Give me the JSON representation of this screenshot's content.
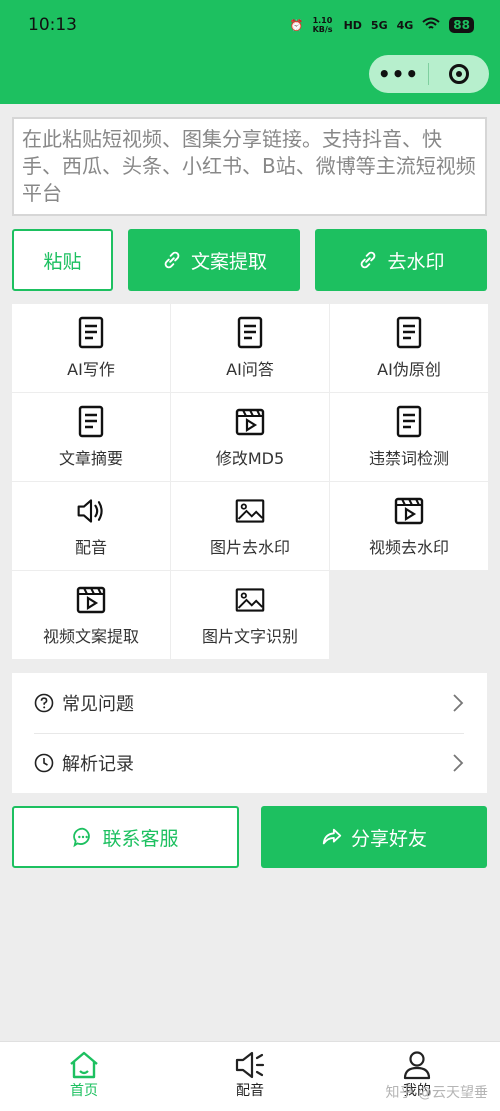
{
  "status": {
    "time": "10:13",
    "speed": "1.10 KB/s",
    "hd": "HD",
    "net5g": "5G",
    "net4g": "4G",
    "battery": "88"
  },
  "input": {
    "placeholder": "在此粘贴短视频、图集分享链接。支持抖音、快手、西瓜、头条、小红书、B站、微博等主流短视频平台"
  },
  "actions": {
    "paste": "粘贴",
    "extract": "文案提取",
    "watermark": "去水印"
  },
  "tools": [
    {
      "label": "AI写作",
      "icon": "document-icon"
    },
    {
      "label": "AI问答",
      "icon": "document-icon"
    },
    {
      "label": "AI伪原创",
      "icon": "document-icon"
    },
    {
      "label": "文章摘要",
      "icon": "document-icon"
    },
    {
      "label": "修改MD5",
      "icon": "video-icon"
    },
    {
      "label": "违禁词检测",
      "icon": "document-icon"
    },
    {
      "label": "配音",
      "icon": "speaker-icon"
    },
    {
      "label": "图片去水印",
      "icon": "image-icon"
    },
    {
      "label": "视频去水印",
      "icon": "video-icon"
    },
    {
      "label": "视频文案提取",
      "icon": "video-icon"
    },
    {
      "label": "图片文字识别",
      "icon": "image-icon"
    }
  ],
  "menu": {
    "faq": "常见问题",
    "history": "解析记录"
  },
  "bottom_actions": {
    "contact": "联系客服",
    "share": "分享好友"
  },
  "tabbar": {
    "home": "首页",
    "dub": "配音",
    "me": "我的"
  },
  "watermark": "知乎 @云天望垂",
  "colors": {
    "accent": "#1dc060",
    "background": "#ededed"
  }
}
